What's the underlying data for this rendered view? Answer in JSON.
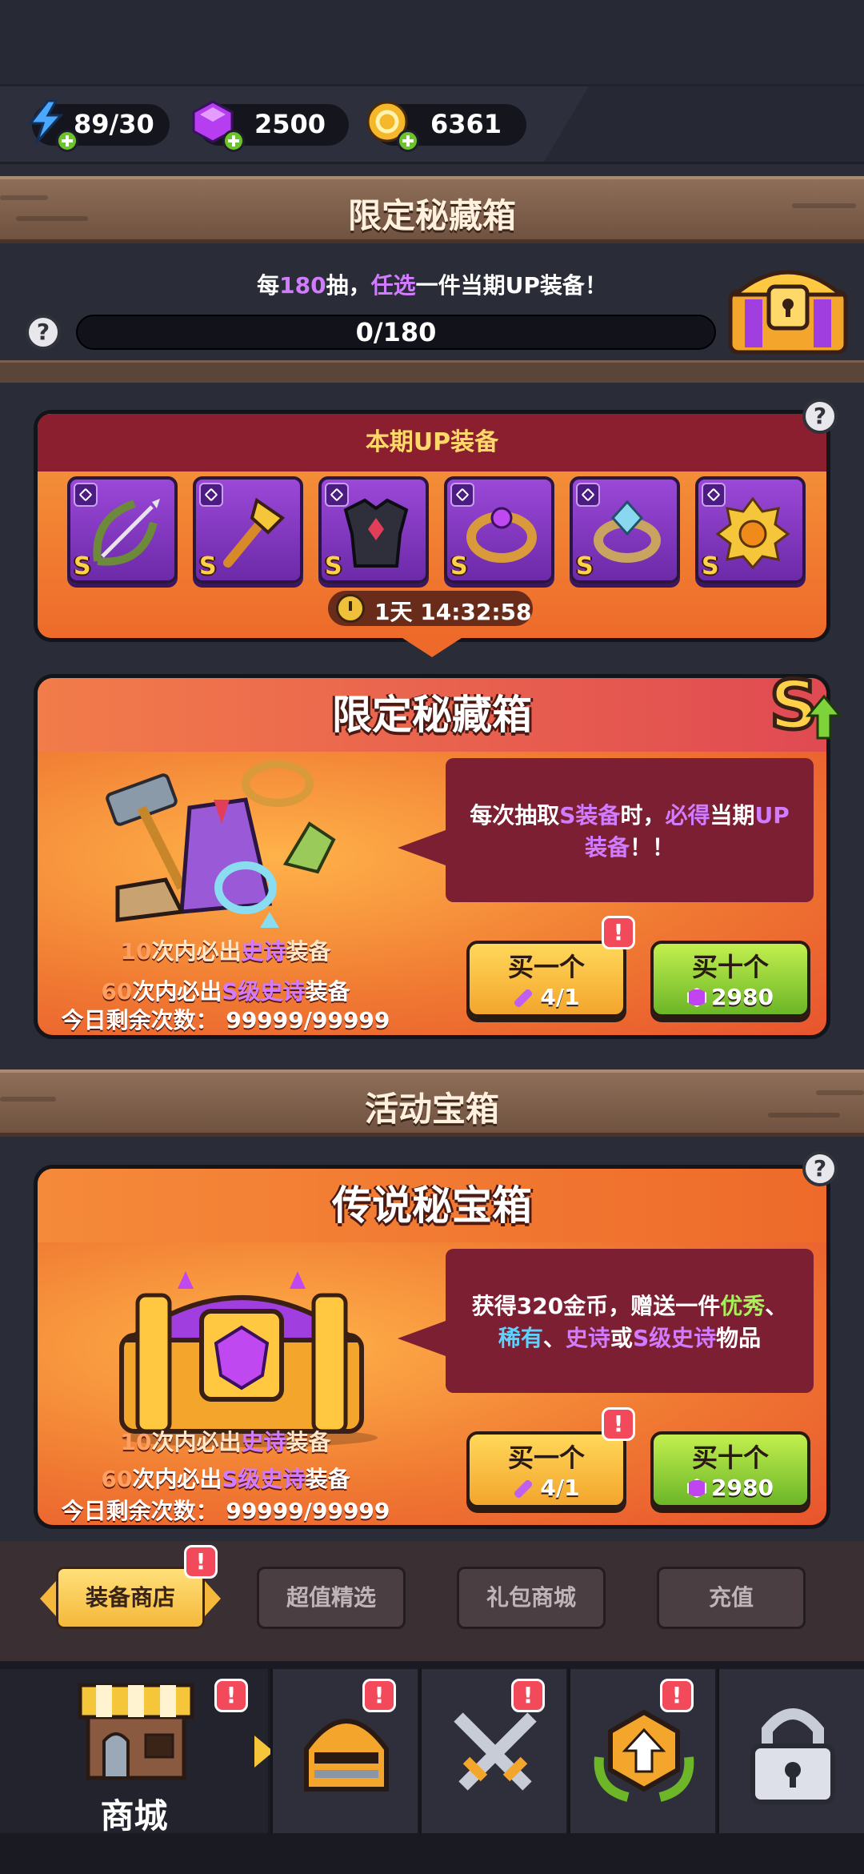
{
  "resources": {
    "energy": "89/30",
    "gems": "2500",
    "gold": "6361"
  },
  "limited_section": {
    "header": "限定秘藏箱",
    "progress_text_parts": [
      "每",
      "180",
      "抽，",
      "任选",
      "一件当期UP装备！"
    ],
    "progress_value": "0/180"
  },
  "up_panel": {
    "title": "本期UP装备",
    "items": [
      {
        "name": "bow-icon",
        "grade": "S"
      },
      {
        "name": "wand-icon",
        "grade": "S"
      },
      {
        "name": "armor-icon",
        "grade": "S"
      },
      {
        "name": "ring-icon",
        "grade": "S"
      },
      {
        "name": "gem-ring-icon",
        "grade": "S"
      },
      {
        "name": "amulet-icon",
        "grade": "S"
      }
    ],
    "timer": "1天 14:32:58"
  },
  "limited_card": {
    "title": "限定秘藏箱",
    "desc_parts": [
      "每次抽取",
      "S装备",
      "时，",
      "必得",
      "当期",
      "UP",
      "装备",
      "！！"
    ],
    "line1_parts": [
      "10",
      "次内必出",
      "史诗",
      "装备"
    ],
    "line2_parts": [
      "60",
      "次内必出",
      "S级史诗",
      "装备"
    ],
    "remaining": "今日剩余次数：  99999/99999",
    "buy_one": {
      "label": "买一个",
      "cost": "4/1"
    },
    "buy_ten": {
      "label": "买十个",
      "cost": "2980"
    },
    "badge": "!"
  },
  "event_section": {
    "header": "活动宝箱"
  },
  "legend_card": {
    "title": "传说秘宝箱",
    "desc_parts": [
      "获得320金币，赠送一件",
      "优秀",
      "、",
      "稀有",
      "、",
      "史诗",
      "或",
      "S级史诗",
      "物品"
    ],
    "line1_parts": [
      "10",
      "次内必出",
      "史诗",
      "装备"
    ],
    "line2_parts": [
      "60",
      "次内必出",
      "S级史诗",
      "装备"
    ],
    "remaining": "今日剩余次数：  99999/99999",
    "buy_one": {
      "label": "买一个",
      "cost": "4/1"
    },
    "buy_ten": {
      "label": "买十个",
      "cost": "2980"
    },
    "badge": "!"
  },
  "shop_tabs": [
    {
      "label": "装备商店",
      "active": true
    },
    {
      "label": "超值精选",
      "active": false
    },
    {
      "label": "礼包商城",
      "active": false
    },
    {
      "label": "充值",
      "active": false
    }
  ],
  "nav": {
    "shop_label": "商城",
    "badge": "!"
  },
  "help_mark": "?",
  "colors": {
    "background": "#2a2c38",
    "panel_orange": "#ee6a2a",
    "panel_red": "#8b1f2f",
    "epic_purple": "#d17bff",
    "buy_green": "#6cb628",
    "buy_yellow": "#f3a52c"
  }
}
